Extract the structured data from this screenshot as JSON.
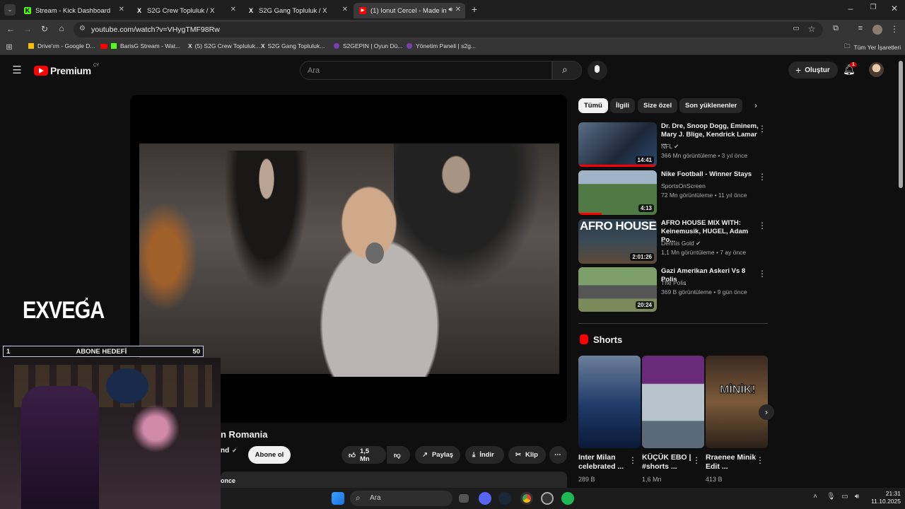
{
  "browser": {
    "tabs": [
      {
        "title": "Stream - Kick Dashboard",
        "favicon": "K",
        "color": "#53fc18"
      },
      {
        "title": "S2G Crew Topluluk / X",
        "favicon": "X",
        "color": "#ffffff"
      },
      {
        "title": "S2G Gang Topluluk / X",
        "favicon": "X",
        "color": "#ffffff"
      },
      {
        "title": "(1) Ionut Cercel - Made in R",
        "favicon": "▶",
        "color": "#ff0000"
      }
    ],
    "url": "youtube.com/watch?v=VHygTMF98Rw",
    "bookmarks": [
      "Drive'ım - Google D...",
      "BarisG Stream - Wat...",
      "(5) S2G Crew Topluluk...",
      "S2G Gang Topluluk...",
      "S2GEPIN | Oyun Dü...",
      "Yönetim Paneli | s2g..."
    ],
    "all_bookmarks": "Tüm Yer İşaretleri"
  },
  "youtube": {
    "logo": "Premium",
    "logo_sup": "CY",
    "search_placeholder": "Ara",
    "create_label": "Oluştur",
    "notif_count": "1"
  },
  "video": {
    "title_visible": "n Romania",
    "channel_partial": "nd",
    "subscribe": "Abone ol",
    "likes": "1,5 Mn",
    "share": "Paylaş",
    "download": "İndir",
    "clip": "Klip",
    "desc_partial": "once"
  },
  "chips": [
    "Tümü",
    "İlgili",
    "Size özel",
    "Son yüklenenler"
  ],
  "related": [
    {
      "title": "Dr. Dre, Snoop Dogg, Eminem, Mary J. Blige, Kendrick Lamar ...",
      "channel": "NFL",
      "meta": "366 Mn görüntüleme • 3 yıl önce",
      "duration": "14:41"
    },
    {
      "title": "Nike Football  - Winner Stays",
      "channel": "SportsOnScreen",
      "meta": "72 Mn görüntüleme • 11 yıl önce",
      "duration": "4:13"
    },
    {
      "title": "AFRO HOUSE MIX WITH: Keinemusik, HUGEL, Adam Po...",
      "channel": "Dennis Gold",
      "meta": "1,1 Mn görüntüleme • 7 ay önce",
      "duration": "2:01:26"
    },
    {
      "title": "Gazi Amerikan Askeri Vs 8 Polis",
      "channel": "The Polis",
      "meta": "369 B görüntüleme • 9 gün önce",
      "duration": "20:24"
    }
  ],
  "shorts": {
    "heading": "Shorts",
    "items": [
      {
        "title": "Inter Milan celebrated ...",
        "views": "289 B"
      },
      {
        "title": "KÜÇÜK EBO | #shorts ...",
        "views": "1,6 Mn"
      },
      {
        "title": "Rraenee Minik Edit ...",
        "views": "413 B"
      }
    ]
  },
  "overlay": {
    "brand": "EXVEGA",
    "goal_label": "ABONE HEDEFİ",
    "goal_current": "1",
    "goal_target": "50"
  },
  "afro_thumb_text": "AFRO HOUSE",
  "minik_text": "MİNİK!",
  "taskbar": {
    "search": "Ara",
    "time": "21:31",
    "date": "11.10.2025"
  }
}
